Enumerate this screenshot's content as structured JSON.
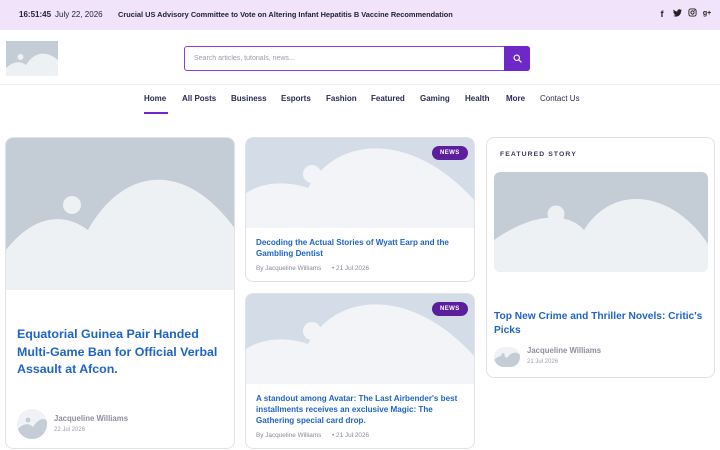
{
  "topbar": {
    "time": "16:51:45",
    "date": "July 22, 2026",
    "ticker": "Crucial US Advisory Committee to Vote on Altering Infant Hepatitis B Vaccine Recommendation",
    "social": [
      {
        "icon": "facebook-icon",
        "glyph": "f"
      },
      {
        "icon": "twitter-icon",
        "glyph": "t"
      },
      {
        "icon": "instagram-icon",
        "glyph": "◎"
      },
      {
        "icon": "google-plus-icon",
        "glyph": "g+"
      }
    ]
  },
  "search": {
    "placeholder": "Search articles, tutorials, news..."
  },
  "nav": {
    "items": [
      "Home",
      "All Posts",
      "Business",
      "Esports",
      "Fashion",
      "Featured",
      "Gaming",
      "Health",
      "More"
    ],
    "contact": "Contact Us",
    "active": "Home"
  },
  "colors": {
    "accent": "#6d28c7",
    "badge": "#5b1f9e",
    "title": "#1f64c4",
    "topbar": "#f0e3fa"
  },
  "main_card": {
    "title": "Equatorial Guinea Pair Handed Multi-Game Ban for Official Verbal Assault at Afcon.",
    "author": "Jacqueline Williams",
    "date": "22 Jul 2026"
  },
  "card_top": {
    "badge": "NEWS",
    "title": "Decoding the Actual Stories of Wyatt Earp and the Gambling Dentist",
    "meta": "By Jacqueline Williams",
    "date": "• 21 Jul 2026"
  },
  "card_bottom": {
    "badge": "NEWS",
    "title": "A standout among Avatar: The Last Airbender's best installments receives an exclusive Magic: The Gathering special card drop.",
    "meta": "By Jacqueline Williams",
    "date": "• 21 Jul 2026"
  },
  "featured": {
    "label": "FEATURED STORY",
    "title": "Top New Crime and Thriller Novels: Critic's Picks",
    "author": "Jacqueline Williams",
    "date": "21 Jul 2026"
  }
}
